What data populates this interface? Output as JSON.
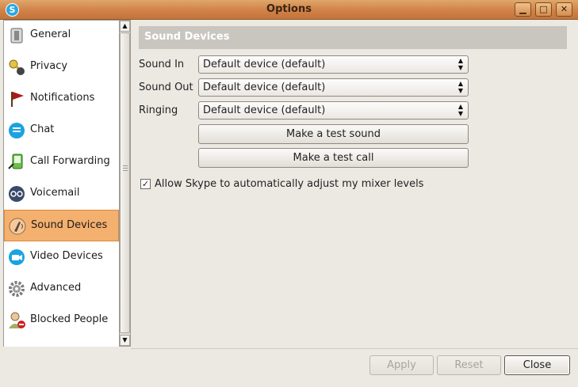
{
  "window": {
    "title": "Options",
    "app_icon_letter": "S",
    "minimize": "▁",
    "maximize": "□",
    "close": "✕"
  },
  "sidebar": {
    "items": [
      {
        "label": "General",
        "icon": "general-icon",
        "color": "#8a8a8a"
      },
      {
        "label": "Privacy",
        "icon": "privacy-icon",
        "color": "#c9a227"
      },
      {
        "label": "Notifications",
        "icon": "notifications-flag-icon",
        "color": "#b01818"
      },
      {
        "label": "Chat",
        "icon": "chat-icon",
        "color": "#1aa3e0"
      },
      {
        "label": "Call Forwarding",
        "icon": "call-forwarding-icon",
        "color": "#4aa02c"
      },
      {
        "label": "Voicemail",
        "icon": "voicemail-icon",
        "color": "#3a4a6a"
      },
      {
        "label": "Sound Devices",
        "icon": "sound-devices-icon",
        "color": "#8a6a4a",
        "active": true
      },
      {
        "label": "Video Devices",
        "icon": "video-devices-icon",
        "color": "#1aa3e0"
      },
      {
        "label": "Advanced",
        "icon": "advanced-gear-icon",
        "color": "#7a7a7a"
      },
      {
        "label": "Blocked People",
        "icon": "blocked-people-icon",
        "color": "#cc2222"
      },
      {
        "label": "",
        "icon": "partial-item-icon",
        "color": "#2a4aaa"
      }
    ]
  },
  "section": {
    "title": "Sound Devices",
    "sound_in_label": "Sound In",
    "sound_in_value": "Default device (default)",
    "sound_out_label": "Sound Out",
    "sound_out_value": "Default device (default)",
    "ringing_label": "Ringing",
    "ringing_value": "Default device (default)",
    "test_sound_label": "Make a test sound",
    "test_call_label": "Make a test call",
    "auto_adjust_label": "Allow Skype to automatically adjust my mixer levels",
    "auto_adjust_checked": true
  },
  "footer": {
    "apply_label": "Apply",
    "reset_label": "Reset",
    "close_label": "Close"
  },
  "colors": {
    "title_bar": "#d2844a",
    "active_item": "#f4b06e",
    "header_bg": "#c9c6c0"
  }
}
